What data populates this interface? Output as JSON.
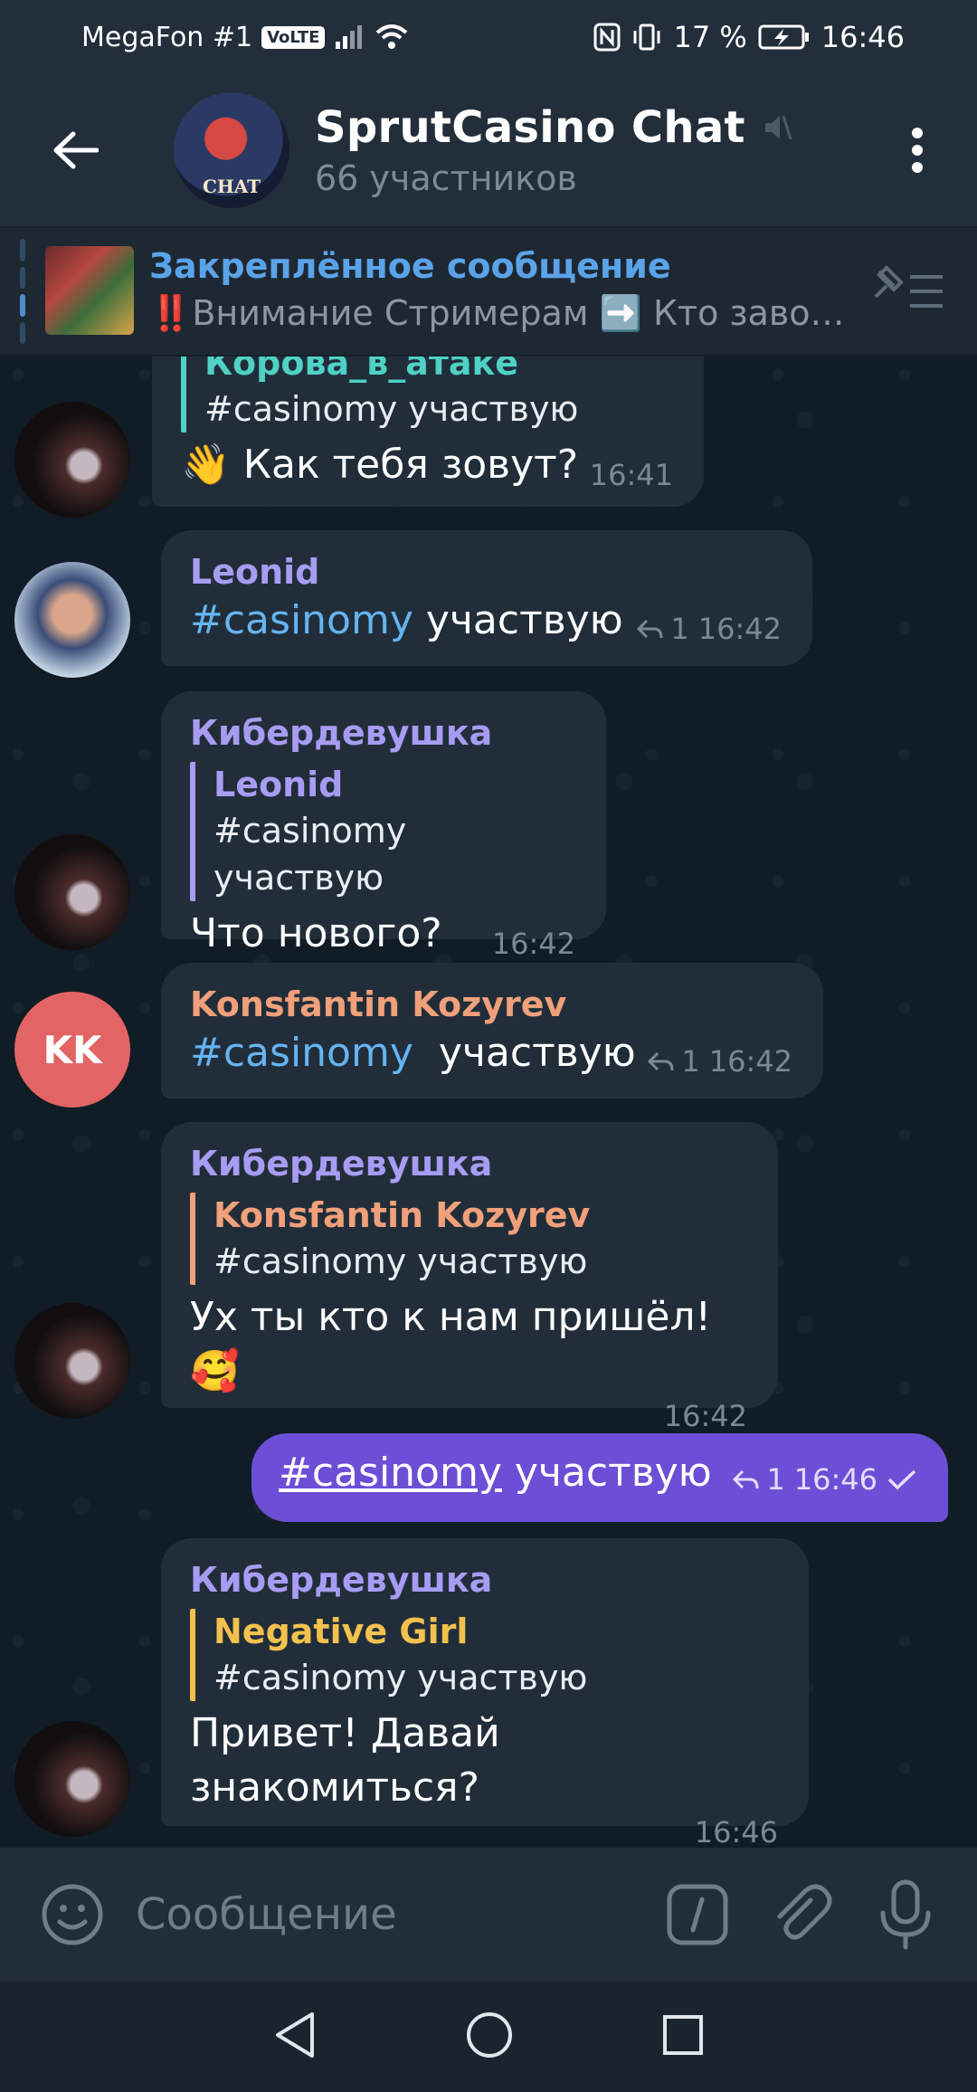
{
  "status_bar": {
    "carrier": "MegaFon #1",
    "volte": "VoLTE",
    "battery": "17 %",
    "time": "16:46"
  },
  "header": {
    "title": "SprutCasino Chat",
    "subtitle": "66 участников",
    "avatar_label": "CHAT"
  },
  "pinned": {
    "title": "Закреплённое сообщение",
    "text": "‼️Внимание Стримерам ➡️ Кто заво…"
  },
  "messages": [
    {
      "reply_name": "Корова_в_атаке",
      "reply_text": "#casinomy участвую",
      "text": "👋 Как тебя зовут?",
      "time": "16:41"
    },
    {
      "sender": "Leonid",
      "hashtag": "#casinomy",
      "text": "участвую",
      "replies": "1",
      "time": "16:42"
    },
    {
      "sender": "Кибердевушка",
      "reply_name": "Leonid",
      "reply_text": "#casinomy участвую",
      "text": "Что нового?",
      "time": "16:42"
    },
    {
      "sender": "Konsfantin Kozyrev",
      "avatar_initials": "KK",
      "hashtag": "#casinomy",
      "text": "участвую",
      "replies": "1",
      "time": "16:42"
    },
    {
      "sender": "Кибердевушка",
      "reply_name": "Konsfantin Kozyrev",
      "reply_text": "#casinomy  участвую",
      "text": "Ух ты кто к нам пришёл! 🥰",
      "time": "16:42"
    },
    {
      "outgoing": true,
      "hashtag": "#casinomy",
      "text": "участвую",
      "replies": "1",
      "time": "16:46"
    },
    {
      "sender": "Кибердевушка",
      "reply_name": "Negative Girl",
      "reply_text": "#casinomy участвую",
      "text": "Привет! Давай знакомиться?",
      "time": "16:46"
    }
  ],
  "input": {
    "placeholder": "Сообщение"
  },
  "colors": {
    "accent_blue": "#5aa3e8",
    "name_purple": "#a79cf2",
    "name_teal": "#4fd1c5",
    "name_orange": "#f0a07a",
    "name_yellow": "#f2c14e",
    "outgoing_bubble": "#6c4fd6"
  },
  "icons": {
    "back": "arrow-left-icon",
    "mute": "muted-speaker-icon",
    "menu": "more-vertical-icon",
    "pin_list": "pinned-list-icon",
    "reply": "reply-arrow-icon",
    "check": "check-icon",
    "emoji": "emoji-icon",
    "commands": "slash-command-icon",
    "attach": "paperclip-icon",
    "mic": "microphone-icon"
  }
}
